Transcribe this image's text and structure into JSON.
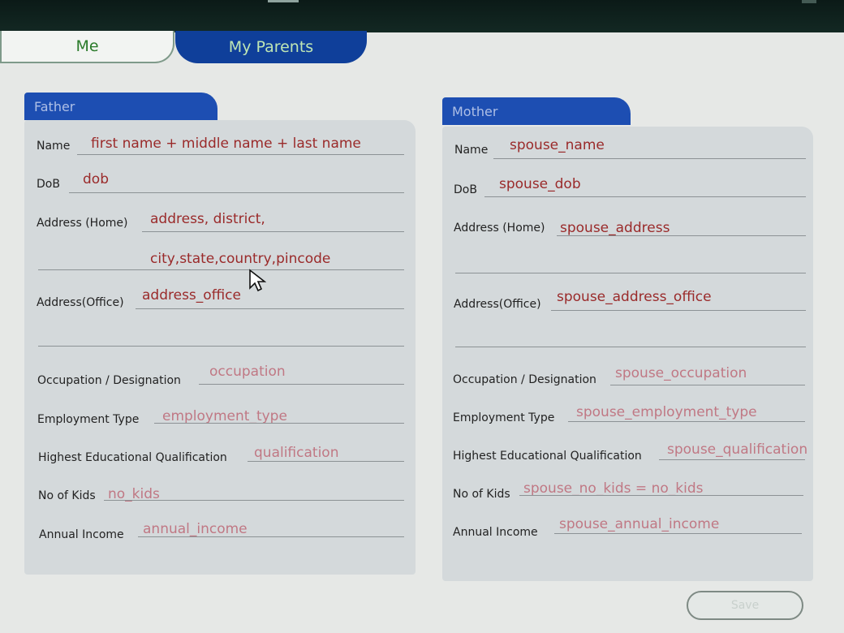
{
  "tabs": {
    "me": "Me",
    "my_parents": "My Parents"
  },
  "father": {
    "title": "Father",
    "name_label": "Name",
    "name_value": "first name + middle name + last name",
    "dob_label": "DoB",
    "dob_value": "dob",
    "addr_home_label": "Address (Home)",
    "addr_home_line1": "address, district,",
    "addr_home_line2": "city,state,country,pincode",
    "addr_office_label": "Address(Office)",
    "addr_office_value": "address_office",
    "occupation_label": "Occupation / Designation",
    "occupation_value": "occupation",
    "employment_label": "Employment Type",
    "employment_value": "employment_type",
    "qualification_label": "Highest Educational Qualification",
    "qualification_value": "qualification",
    "kids_label": "No of Kids",
    "kids_value": "no_kids",
    "income_label": "Annual Income",
    "income_value": "annual_income"
  },
  "mother": {
    "title": "Mother",
    "name_label": "Name",
    "name_value": "spouse_name",
    "dob_label": "DoB",
    "dob_value": "spouse_dob",
    "addr_home_label": "Address (Home)",
    "addr_home_value": "spouse_address",
    "addr_office_label": "Address(Office)",
    "addr_office_value": "spouse_address_office",
    "occupation_label": "Occupation / Designation",
    "occupation_value": "spouse_occupation",
    "employment_label": "Employment Type",
    "employment_value": "spouse_employment_type",
    "qualification_label": "Highest Educational Qualification",
    "qualification_value": "spouse_qualification",
    "kids_label": "No of Kids",
    "kids_value": "spouse_no_kids = no_kids",
    "income_label": "Annual Income",
    "income_value": "spouse_annual_income"
  },
  "save_label": "Save"
}
